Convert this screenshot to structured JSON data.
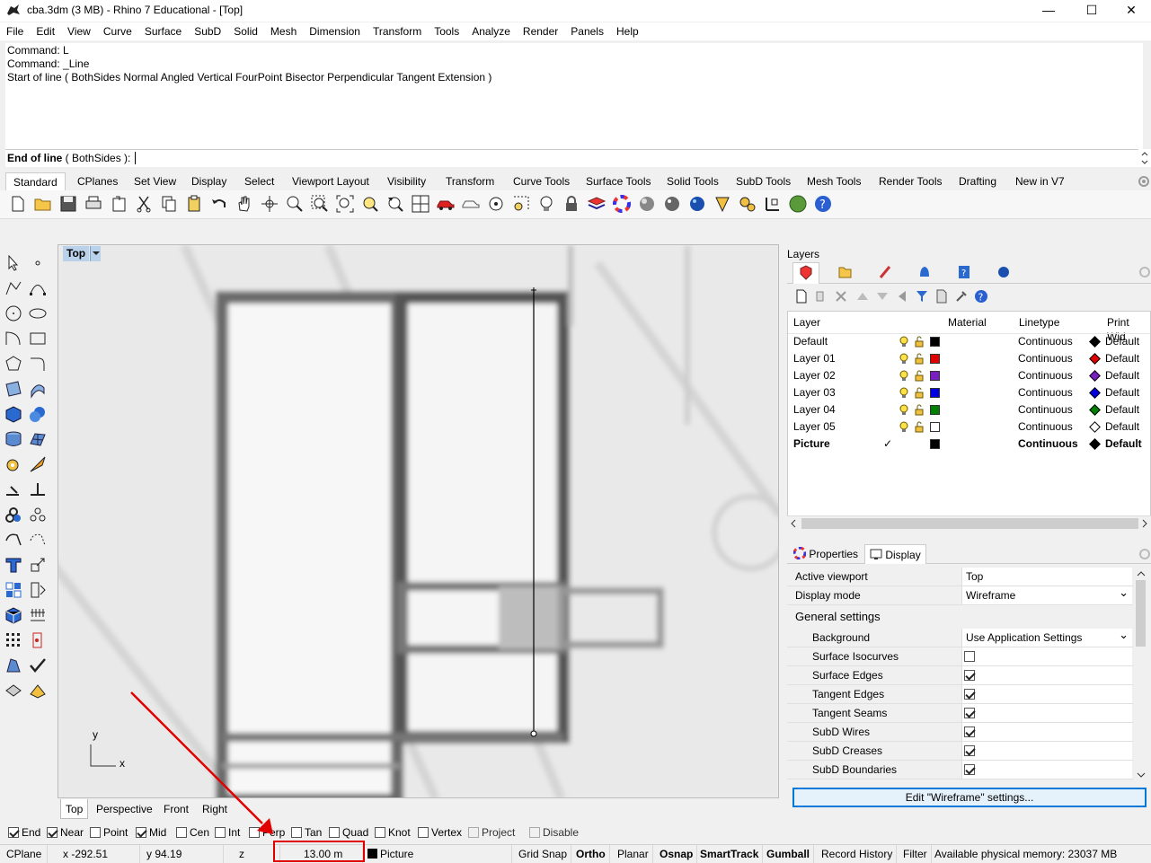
{
  "window": {
    "title": "cba.3dm (3 MB) - Rhino 7 Educational - [Top]",
    "minimize_glyph": "—",
    "maximize_glyph": "☐",
    "close_glyph": "✕"
  },
  "menu": [
    "File",
    "Edit",
    "View",
    "Curve",
    "Surface",
    "SubD",
    "Solid",
    "Mesh",
    "Dimension",
    "Transform",
    "Tools",
    "Analyze",
    "Render",
    "Panels",
    "Help"
  ],
  "command": {
    "history": [
      "Command: L",
      "Command: _Line",
      "Start of line ( BothSides  Normal  Angled  Vertical  FourPoint  Bisector  Perpendicular  Tangent  Extension )"
    ],
    "prompt": "End of line",
    "prompt_options": " ( BothSides ): "
  },
  "toolbar_tabs": [
    "Standard",
    "CPlanes",
    "Set View",
    "Display",
    "Select",
    "Viewport Layout",
    "Visibility",
    "Transform",
    "Curve Tools",
    "Surface Tools",
    "Solid Tools",
    "SubD Tools",
    "Mesh Tools",
    "Render Tools",
    "Drafting",
    "New in V7"
  ],
  "viewport": {
    "title": "Top",
    "axis_x": "x",
    "axis_y": "y"
  },
  "viewport_tabs": [
    "Top",
    "Perspective",
    "Front",
    "Right"
  ],
  "osnaps": [
    {
      "label": "End",
      "checked": true
    },
    {
      "label": "Near",
      "checked": true
    },
    {
      "label": "Point",
      "checked": false
    },
    {
      "label": "Mid",
      "checked": true
    },
    {
      "label": "Cen",
      "checked": false
    },
    {
      "label": "Int",
      "checked": false
    },
    {
      "label": "Perp",
      "checked": false
    },
    {
      "label": "Tan",
      "checked": false
    },
    {
      "label": "Quad",
      "checked": false
    },
    {
      "label": "Knot",
      "checked": false
    },
    {
      "label": "Vertex",
      "checked": false
    },
    {
      "label": "Project",
      "checked": false
    },
    {
      "label": "Disable",
      "checked": false
    }
  ],
  "status": {
    "cplane": "CPlane",
    "x": "x -292.51",
    "y": "y 94.19",
    "z": "z",
    "distance": "13.00 m",
    "layer": "Picture",
    "grid_snap": "Grid Snap",
    "ortho": "Ortho",
    "planar": "Planar",
    "osnap": "Osnap",
    "smarttrack": "SmartTrack",
    "gumball": "Gumball",
    "record_history": "Record History",
    "filter": "Filter",
    "memory": "Available physical memory: 23037 MB"
  },
  "layers": {
    "panel_title": "Layers",
    "headers": {
      "layer": "Layer",
      "material": "Material",
      "linetype": "Linetype",
      "print_width": "Print Wid"
    },
    "rows": [
      {
        "name": "Default",
        "color": "#000000",
        "linetype": "Continuous",
        "print": "Default",
        "current": false
      },
      {
        "name": "Layer 01",
        "color": "#e00000",
        "linetype": "Continuous",
        "print": "Default",
        "current": false
      },
      {
        "name": "Layer 02",
        "color": "#7a1fbf",
        "linetype": "Continuous",
        "print": "Default",
        "current": false
      },
      {
        "name": "Layer 03",
        "color": "#0000e0",
        "linetype": "Continuous",
        "print": "Default",
        "current": false
      },
      {
        "name": "Layer 04",
        "color": "#008000",
        "linetype": "Continuous",
        "print": "Default",
        "current": false
      },
      {
        "name": "Layer 05",
        "color": "#ffffff",
        "linetype": "Continuous",
        "print": "Default",
        "current": false
      },
      {
        "name": "Picture",
        "color": "#000000",
        "linetype": "Continuous",
        "print": "Default",
        "current": true
      }
    ],
    "current_mark": "✓"
  },
  "properties": {
    "tab_properties": "Properties",
    "tab_display": "Display",
    "active_viewport_label": "Active viewport",
    "active_viewport_value": "Top",
    "display_mode_label": "Display mode",
    "display_mode_value": "Wireframe",
    "general_settings": "General settings",
    "background_label": "Background",
    "background_value": "Use Application Settings",
    "checks": [
      {
        "label": "Surface Isocurves",
        "checked": false
      },
      {
        "label": "Surface Edges",
        "checked": true
      },
      {
        "label": "Tangent Edges",
        "checked": true
      },
      {
        "label": "Tangent Seams",
        "checked": true
      },
      {
        "label": "SubD Wires",
        "checked": true
      },
      {
        "label": "SubD Creases",
        "checked": true
      },
      {
        "label": "SubD Boundaries",
        "checked": true
      }
    ],
    "edit_button": "Edit \"Wireframe\" settings..."
  }
}
